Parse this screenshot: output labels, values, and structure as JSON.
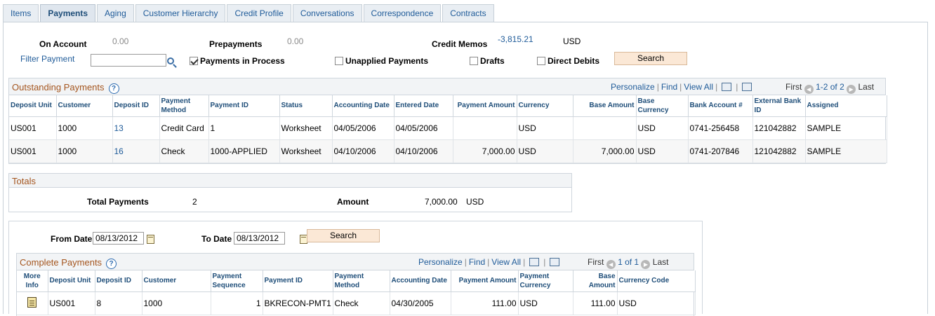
{
  "tabs": [
    {
      "label": "Items"
    },
    {
      "label": "Payments"
    },
    {
      "label": "Aging"
    },
    {
      "label": "Customer Hierarchy"
    },
    {
      "label": "Credit Profile"
    },
    {
      "label": "Conversations"
    },
    {
      "label": "Correspondence"
    },
    {
      "label": "Contracts"
    }
  ],
  "summary": {
    "on_account_label": "On Account",
    "on_account_value": "0.00",
    "prepayments_label": "Prepayments",
    "prepayments_value": "0.00",
    "credit_memos_label": "Credit Memos",
    "credit_memos_value": "-3,815.21",
    "currency": "USD"
  },
  "filters": {
    "filter_payment_label": "Filter Payment",
    "filter_payment_value": "",
    "payments_in_process_label": "Payments in Process",
    "payments_in_process_checked": true,
    "unapplied_label": "Unapplied Payments",
    "drafts_label": "Drafts",
    "direct_debits_label": "Direct Debits",
    "search_label": "Search"
  },
  "outstanding": {
    "title": "Outstanding Payments",
    "nav": {
      "personalize": "Personalize",
      "find": "Find",
      "view_all": "View All",
      "first": "First",
      "range": "1-2 of 2",
      "last": "Last"
    },
    "columns": [
      "Deposit Unit",
      "Customer",
      "Deposit ID",
      "Payment Method",
      "Payment ID",
      "Status",
      "Accounting Date",
      "Entered Date",
      "Payment Amount",
      "Currency",
      "Base Amount",
      "Base Currency",
      "Bank Account #",
      "External Bank ID",
      "Assigned"
    ],
    "rows": [
      {
        "deposit_unit": "US001",
        "customer": "1000",
        "deposit_id": "13",
        "payment_method": "Credit Card",
        "payment_id": "1",
        "status": "Worksheet",
        "accounting_date": "04/05/2006",
        "entered_date": "04/05/2006",
        "payment_amount": "",
        "currency": "USD",
        "base_amount": "",
        "base_currency": "USD",
        "bank_account": "0741-256458",
        "external_bank_id": "121042882",
        "assigned": "SAMPLE"
      },
      {
        "deposit_unit": "US001",
        "customer": "1000",
        "deposit_id": "16",
        "payment_method": "Check",
        "payment_id": "1000-APPLIED",
        "status": "Worksheet",
        "accounting_date": "04/10/2006",
        "entered_date": "04/10/2006",
        "payment_amount": "7,000.00",
        "currency": "USD",
        "base_amount": "7,000.00",
        "base_currency": "USD",
        "bank_account": "0741-207846",
        "external_bank_id": "121042882",
        "assigned": "SAMPLE"
      }
    ]
  },
  "totals": {
    "title": "Totals",
    "total_payments_label": "Total Payments",
    "total_payments_value": "2",
    "amount_label": "Amount",
    "amount_value": "7,000.00",
    "currency": "USD"
  },
  "complete_search": {
    "from_date_label": "From Date",
    "from_date_value": "08/13/2012",
    "to_date_label": "To Date",
    "to_date_value": "08/13/2012",
    "search_label": "Search"
  },
  "complete": {
    "title": "Complete Payments",
    "nav": {
      "personalize": "Personalize",
      "find": "Find",
      "view_all": "View All",
      "first": "First",
      "range": "1 of 1",
      "last": "Last"
    },
    "columns": [
      "More Info",
      "Deposit Unit",
      "Deposit ID",
      "Customer",
      "Payment Sequence",
      "Payment ID",
      "Payment Method",
      "Accounting Date",
      "Payment Amount",
      "Payment Currency",
      "Base Amount",
      "Currency Code"
    ],
    "rows": [
      {
        "deposit_unit": "US001",
        "deposit_id": "8",
        "customer": "1000",
        "payment_sequence": "1",
        "payment_id": "BKRECON-PMT1",
        "payment_method": "Check",
        "accounting_date": "04/30/2005",
        "payment_amount": "111.00",
        "payment_currency": "USD",
        "base_amount": "111.00",
        "currency_code": "USD"
      }
    ]
  },
  "icons": {
    "lookup": "magnifier-icon",
    "help": "help-icon",
    "calendar": "calendar-icon",
    "more_info": "document-icon",
    "zoom": "new-window-icon",
    "download": "spreadsheet-icon"
  },
  "colors": {
    "link": "#1f5b99",
    "section_title": "#a4551e",
    "button_bg": "#fbe8d6"
  }
}
